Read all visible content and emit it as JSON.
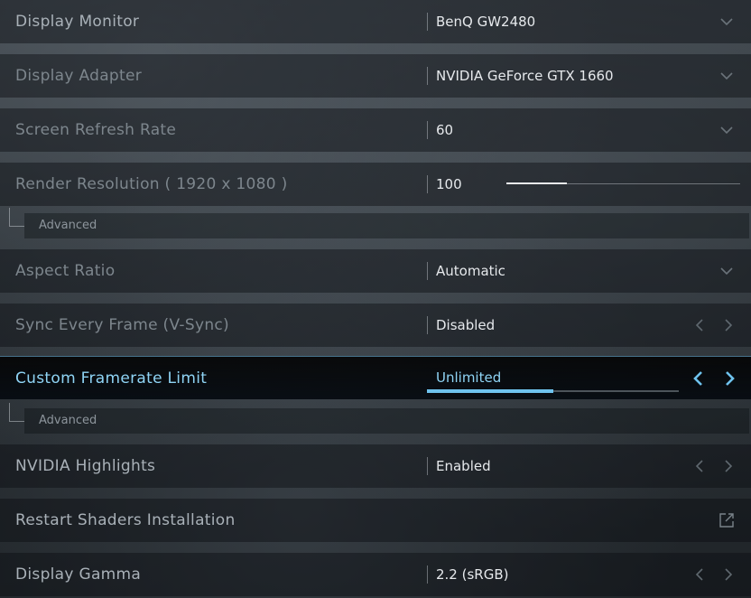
{
  "settings": {
    "display_monitor": {
      "label": "Display Monitor",
      "value": "BenQ GW2480"
    },
    "display_adapter": {
      "label": "Display Adapter",
      "value": "NVIDIA GeForce GTX 1660"
    },
    "refresh_rate": {
      "label": "Screen Refresh Rate",
      "value": "60"
    },
    "render_resolution": {
      "label": "Render Resolution ( 1920 x 1080 )",
      "value": "100",
      "slider_fraction": 0.26
    },
    "render_advanced": {
      "label": "Advanced"
    },
    "aspect_ratio": {
      "label": "Aspect Ratio",
      "value": "Automatic"
    },
    "vsync": {
      "label": "Sync Every Frame (V-Sync)",
      "value": "Disabled"
    },
    "framerate_limit": {
      "label": "Custom Framerate Limit",
      "value": "Unlimited",
      "bar_fraction": 0.5
    },
    "framerate_advanced": {
      "label": "Advanced"
    },
    "nvidia_highlights": {
      "label": "NVIDIA Highlights",
      "value": "Enabled"
    },
    "restart_shaders": {
      "label": "Restart Shaders Installation"
    },
    "display_gamma": {
      "label": "Display Gamma",
      "value": "2.2 (sRGB)"
    }
  },
  "icons": {
    "dropdown": "chevron-down-icon",
    "cycle_left": "chevron-left-icon",
    "cycle_right": "chevron-right-icon",
    "external": "external-link-icon"
  },
  "colors": {
    "accent": "#6fc3ee",
    "accent_text": "#8fd4f5"
  }
}
